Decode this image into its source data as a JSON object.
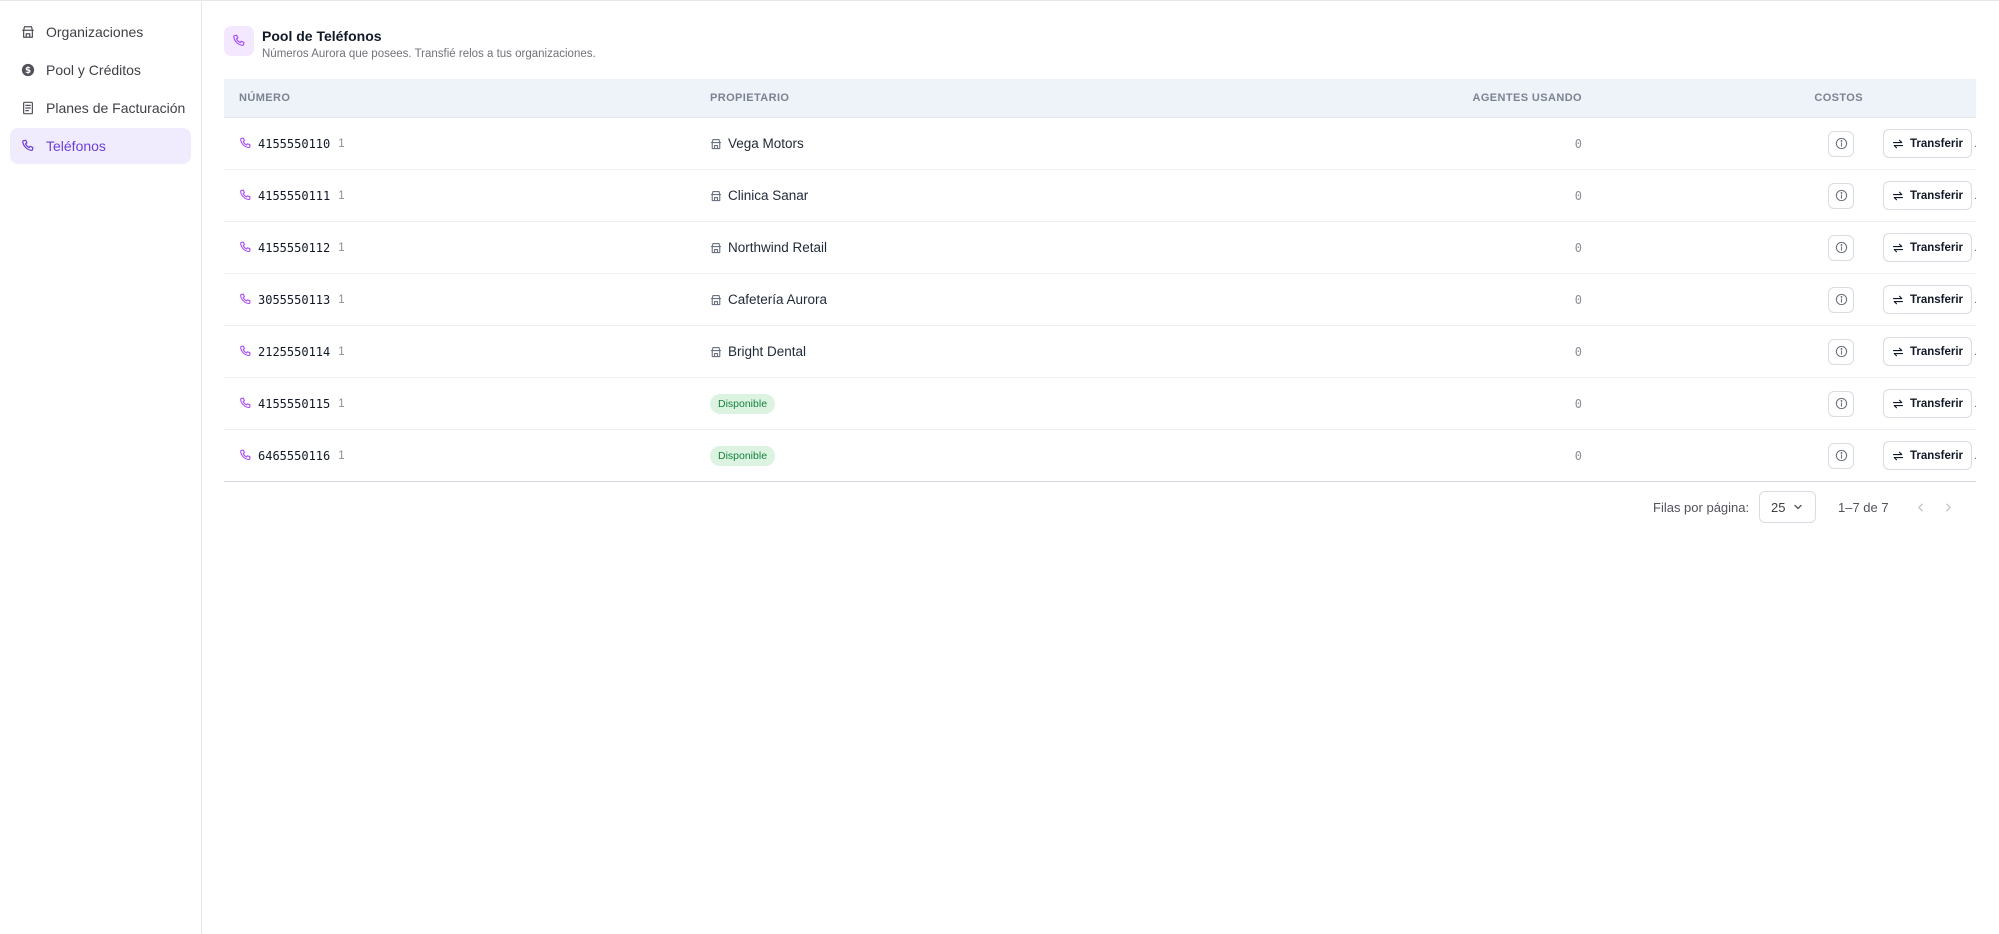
{
  "sidebar": {
    "items": [
      {
        "label": "Organizaciones",
        "icon": "store-icon",
        "active": false
      },
      {
        "label": "Pool y Créditos",
        "icon": "dollar-coin-icon",
        "active": false
      },
      {
        "label": "Planes de Facturación",
        "icon": "receipt-icon",
        "active": false
      },
      {
        "label": "Teléfonos",
        "icon": "phone-icon",
        "active": true
      }
    ]
  },
  "header": {
    "title": "Pool de Teléfonos",
    "subtitle": "Números Aurora que posees. Transfié relos a tus organizaciones."
  },
  "table": {
    "columns": {
      "number": "NÚMERO",
      "owner": "PROPIETARIO",
      "agents": "AGENTES USANDO",
      "costs": "COSTOS"
    },
    "rows": [
      {
        "number": "4155550110",
        "count": "1",
        "owner": "Vega Motors",
        "status": "",
        "agents": "0",
        "action": "Transferir",
        "trailing": "."
      },
      {
        "number": "4155550111",
        "count": "1",
        "owner": "Clinica Sanar",
        "status": "",
        "agents": "0",
        "action": "Transferir",
        "trailing": "."
      },
      {
        "number": "4155550112",
        "count": "1",
        "owner": "Northwind Retail",
        "status": "",
        "agents": "0",
        "action": "Transferir",
        "trailing": "."
      },
      {
        "number": "3055550113",
        "count": "1",
        "owner": "Cafetería Aurora",
        "status": "",
        "agents": "0",
        "action": "Transferir",
        "trailing": "."
      },
      {
        "number": "2125550114",
        "count": "1",
        "owner": "Bright Dental",
        "status": "",
        "agents": "0",
        "action": "Transferir",
        "trailing": "."
      },
      {
        "number": "4155550115",
        "count": "1",
        "owner": "",
        "status": "Disponible",
        "agents": "0",
        "action": "Transferir",
        "trailing": "."
      },
      {
        "number": "6465550116",
        "count": "1",
        "owner": "",
        "status": "Disponible",
        "agents": "0",
        "action": "Transferir",
        "trailing": "."
      }
    ]
  },
  "pagination": {
    "rows_label": "Filas por página:",
    "page_size": "25",
    "range": "1–7 de 7"
  },
  "colors": {
    "accent": "#6d3fd8",
    "accent_bg": "#f1ecfd",
    "success_text": "#15803d",
    "success_bg": "#dcf3e2"
  }
}
